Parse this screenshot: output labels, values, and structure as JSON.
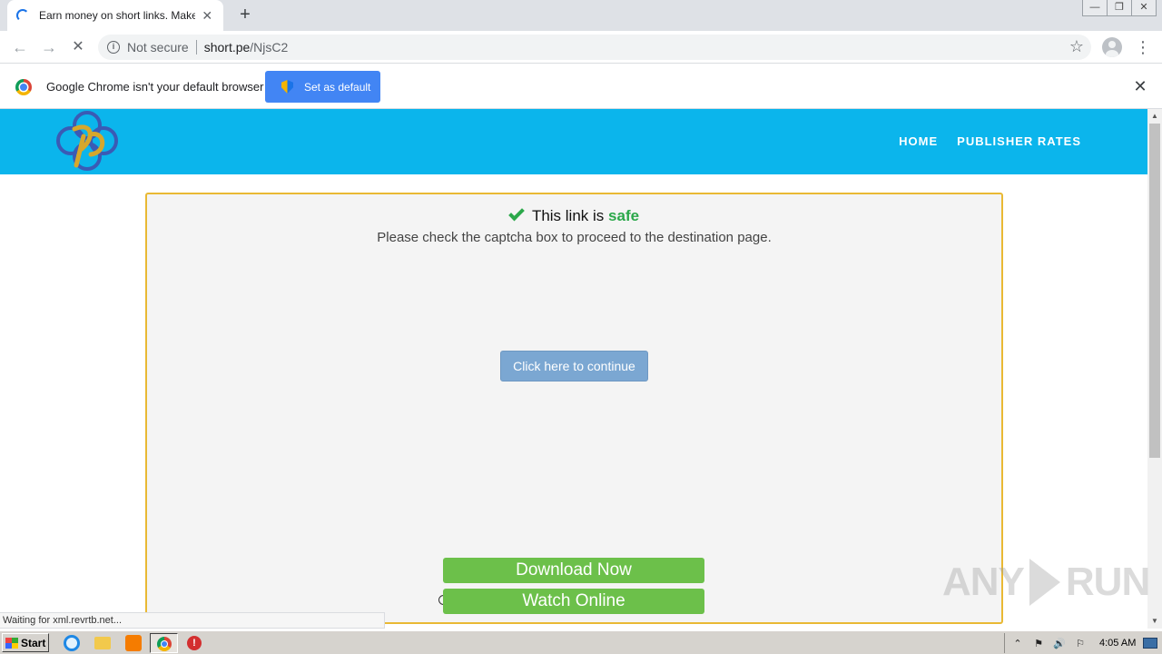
{
  "browser": {
    "tab": {
      "title": "Earn money on short links. Make short links and earn t",
      "close_glyph": "✕"
    },
    "new_tab_glyph": "+",
    "window_controls": {
      "minimize": "—",
      "restore": "❐",
      "close": "✕"
    },
    "nav": {
      "back": "←",
      "forward": "→",
      "stop": "✕"
    },
    "omnibox": {
      "security_label": "Not secure",
      "host": "short.pe",
      "path": "/NjsC2"
    },
    "bookmark_glyph": "☆",
    "menu_glyph": "⋮",
    "infobar": {
      "message": "Google Chrome isn't your default browser",
      "button_label": "Set as default",
      "close_glyph": "✕"
    },
    "status_bubble": "Waiting for xml.revrtb.net..."
  },
  "page": {
    "nav": [
      "HOME",
      "PUBLISHER RATES"
    ],
    "safe_prefix": "This link is",
    "safe_word": "safe",
    "instruction": "Please check the captcha box to proceed to the destination page.",
    "continue_label": "Click here to continue",
    "download_label": "Download Now",
    "watch_label": "Watch Online",
    "colors": {
      "header": "#0bb5ec",
      "card_border": "#e9b934",
      "safe_green": "#2ba84a",
      "button_green": "#6cc04a",
      "continue_blue": "#7ba7d2"
    }
  },
  "watermark": {
    "left": "ANY",
    "right": "RUN"
  },
  "taskbar": {
    "start_label": "Start",
    "tray_glyphs": [
      "⌃",
      "⚑",
      "🔊",
      "⚐"
    ],
    "clock": "4:05 AM",
    "icons": [
      "ie-icon",
      "folder-icon",
      "media-player-icon",
      "chrome-icon",
      "opera-icon"
    ]
  }
}
